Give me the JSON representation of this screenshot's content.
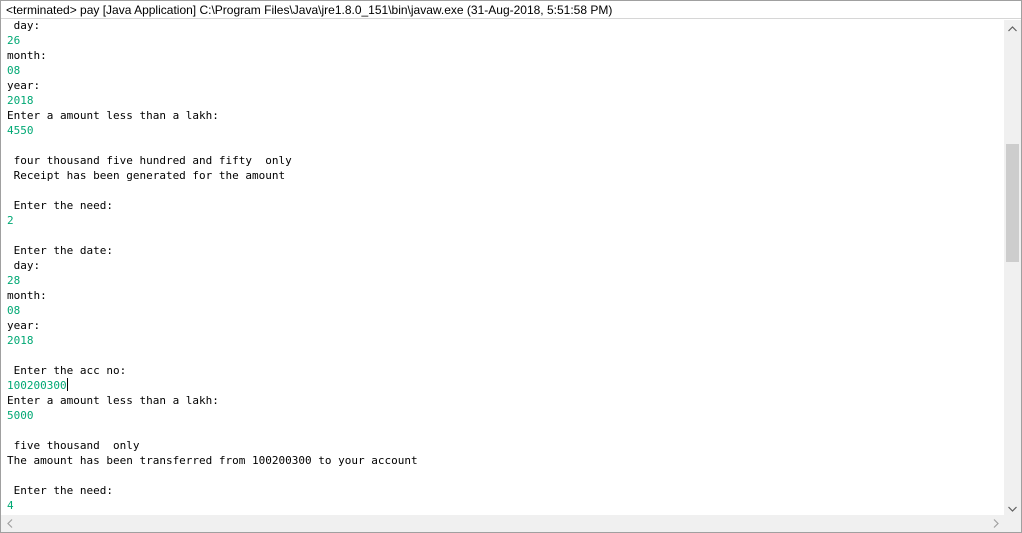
{
  "window": {
    "title": "<terminated> pay [Java Application] C:\\Program Files\\Java\\jre1.8.0_151\\bin\\javaw.exe (31-Aug-2018, 5:51:58 PM)"
  },
  "console": {
    "lines": [
      {
        "text": " day:",
        "kind": "output"
      },
      {
        "text": "26",
        "kind": "input"
      },
      {
        "text": "month:",
        "kind": "output"
      },
      {
        "text": "08",
        "kind": "input"
      },
      {
        "text": "year:",
        "kind": "output"
      },
      {
        "text": "2018",
        "kind": "input"
      },
      {
        "text": "Enter a amount less than a lakh:",
        "kind": "output"
      },
      {
        "text": "4550",
        "kind": "input"
      },
      {
        "text": "",
        "kind": "output"
      },
      {
        "text": " four thousand five hundred and fifty  only",
        "kind": "output"
      },
      {
        "text": " Receipt has been generated for the amount",
        "kind": "output"
      },
      {
        "text": "",
        "kind": "output"
      },
      {
        "text": " Enter the need:",
        "kind": "output"
      },
      {
        "text": "2",
        "kind": "input"
      },
      {
        "text": "",
        "kind": "output"
      },
      {
        "text": " Enter the date:",
        "kind": "output"
      },
      {
        "text": " day:",
        "kind": "output"
      },
      {
        "text": "28",
        "kind": "input"
      },
      {
        "text": "month:",
        "kind": "output"
      },
      {
        "text": "08",
        "kind": "input"
      },
      {
        "text": "year:",
        "kind": "output"
      },
      {
        "text": "2018",
        "kind": "input"
      },
      {
        "text": "",
        "kind": "output"
      },
      {
        "text": " Enter the acc no:",
        "kind": "output"
      },
      {
        "text": "100200300",
        "kind": "input",
        "caret": true
      },
      {
        "text": "Enter a amount less than a lakh:",
        "kind": "output"
      },
      {
        "text": "5000",
        "kind": "input"
      },
      {
        "text": "",
        "kind": "output"
      },
      {
        "text": " five thousand  only",
        "kind": "output"
      },
      {
        "text": "The amount has been transferred from 100200300 to your account",
        "kind": "output"
      },
      {
        "text": "",
        "kind": "output"
      },
      {
        "text": " Enter the need:",
        "kind": "output"
      },
      {
        "text": "4",
        "kind": "input"
      }
    ]
  },
  "scrollbars": {
    "vertical_icons": [
      "chevron-up-icon",
      "chevron-down-icon"
    ],
    "horizontal_icons": [
      "chevron-left-icon",
      "chevron-right-icon"
    ]
  },
  "colors": {
    "input_text": "#00a874",
    "output_text": "#000000",
    "scrollbar_track": "#f0f0f0",
    "scrollbar_thumb": "#cdcdcd"
  }
}
